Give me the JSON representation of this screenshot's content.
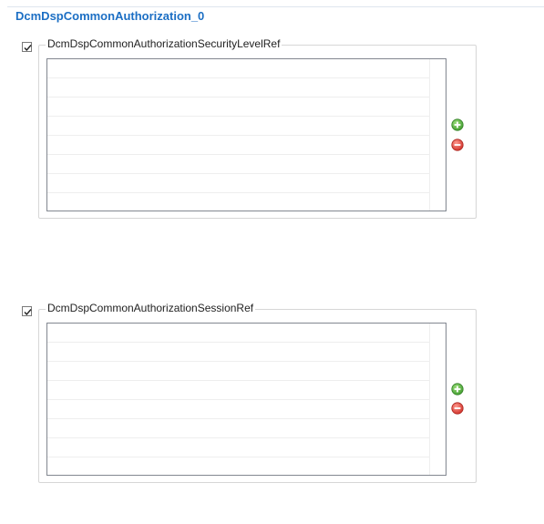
{
  "page": {
    "title": "DcmDspCommonAuthorization_0"
  },
  "groups": [
    {
      "label": "DcmDspCommonAuthorizationSecurityLevelRef",
      "checked": true,
      "rows": []
    },
    {
      "label": "DcmDspCommonAuthorizationSessionRef",
      "checked": true,
      "rows": []
    }
  ],
  "icons": {
    "add": "add-icon",
    "remove": "remove-icon",
    "checkmark": "checkmark-icon"
  },
  "colors": {
    "title": "#1c6fc4",
    "add": "#4caf3a",
    "remove": "#e0443e"
  }
}
